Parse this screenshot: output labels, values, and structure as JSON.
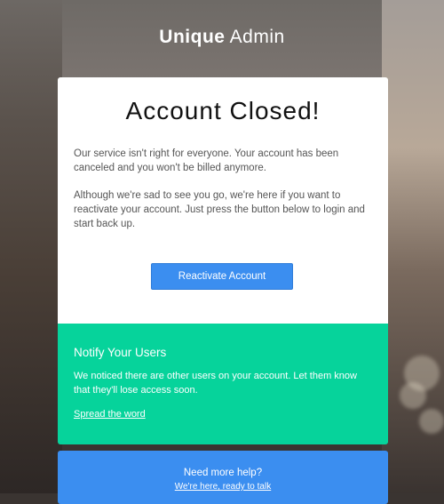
{
  "brand": {
    "bold": "Unique",
    "light": "Admin"
  },
  "card": {
    "title": "Account Closed!",
    "paragraph1": "Our service isn't right for everyone. Your account has been canceled and you won't be billed anymore.",
    "paragraph2": "Although we're sad to see you go, we're here if you want to reactivate your account. Just press the button below to login and start back up.",
    "button_label": "Reactivate Account"
  },
  "notify": {
    "title": "Notify Your Users",
    "text": "We noticed there are other users on your account. Let them know that they'll lose access soon.",
    "link": "Spread the word"
  },
  "help": {
    "question": "Need more help?",
    "link": "We're here, ready to talk"
  },
  "colors": {
    "primary": "#3b8ef0",
    "notify_bg": "#06d39b",
    "card_bg": "#ffffff",
    "text_muted": "#555555"
  }
}
